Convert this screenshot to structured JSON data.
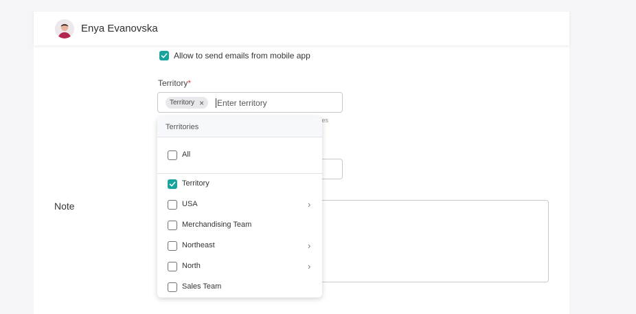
{
  "header": {
    "user_name": "Enya Evanovska"
  },
  "form": {
    "allow_mobile_email": {
      "label": "Allow to send emails from mobile app",
      "checked": true
    },
    "territory": {
      "label": "Territory",
      "required_mark": "*",
      "chip": "Territory",
      "placeholder": "Enter territory",
      "hint": "tories"
    },
    "note": {
      "label": "Note"
    }
  },
  "dropdown": {
    "title": "Territories",
    "all_label": "All",
    "items": [
      {
        "label": "Territory",
        "checked": true,
        "has_children": false
      },
      {
        "label": "USA",
        "checked": false,
        "has_children": true
      },
      {
        "label": "Merchandising Team",
        "checked": false,
        "has_children": false
      },
      {
        "label": "Northeast",
        "checked": false,
        "has_children": true
      },
      {
        "label": "North",
        "checked": false,
        "has_children": true
      },
      {
        "label": "Sales Team",
        "checked": false,
        "has_children": false
      }
    ]
  },
  "colors": {
    "accent": "#19a39c",
    "required": "#d43c3c"
  }
}
